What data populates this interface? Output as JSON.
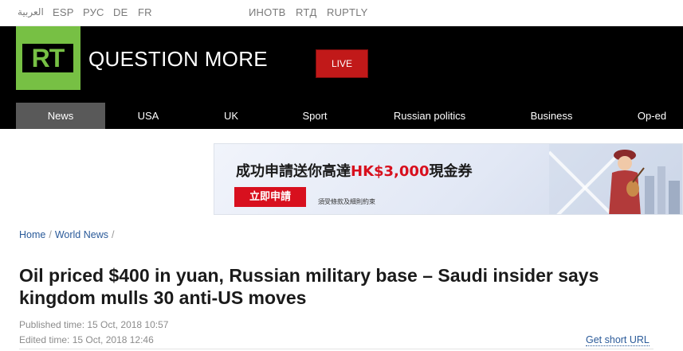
{
  "languages": [
    "العربية",
    "ESP",
    "РУС",
    "DE",
    "FR",
    "ИНОТВ",
    "RTД",
    "RUPTLY"
  ],
  "header": {
    "logo_text": "RT",
    "tagline": "QUESTION MORE",
    "live_label": "LIVE"
  },
  "nav": {
    "items": [
      {
        "label": "News",
        "active": true
      },
      {
        "label": "USA"
      },
      {
        "label": "UK"
      },
      {
        "label": "Sport"
      },
      {
        "label": "Russian politics"
      },
      {
        "label": "Business"
      },
      {
        "label": "Op-ed"
      }
    ]
  },
  "ad": {
    "headline_prefix": "成功申請送你高達",
    "headline_amount": "HK$3,000",
    "headline_suffix": "現金券",
    "cta": "立即申請",
    "terms": "須受條款及細則約束"
  },
  "breadcrumb": [
    "Home",
    "World News"
  ],
  "article": {
    "title": "Oil priced $400 in yuan, Russian military base – Saudi insider says kingdom mulls 30 anti-US moves",
    "published": "Published time: 15 Oct, 2018 10:57",
    "edited": "Edited time: 15 Oct, 2018 12:46",
    "short_url_label": "Get short URL"
  },
  "colors": {
    "brand_green": "#77c044",
    "live_red": "#c11919",
    "link_blue": "#2a5a99",
    "nav_active": "#595959"
  }
}
